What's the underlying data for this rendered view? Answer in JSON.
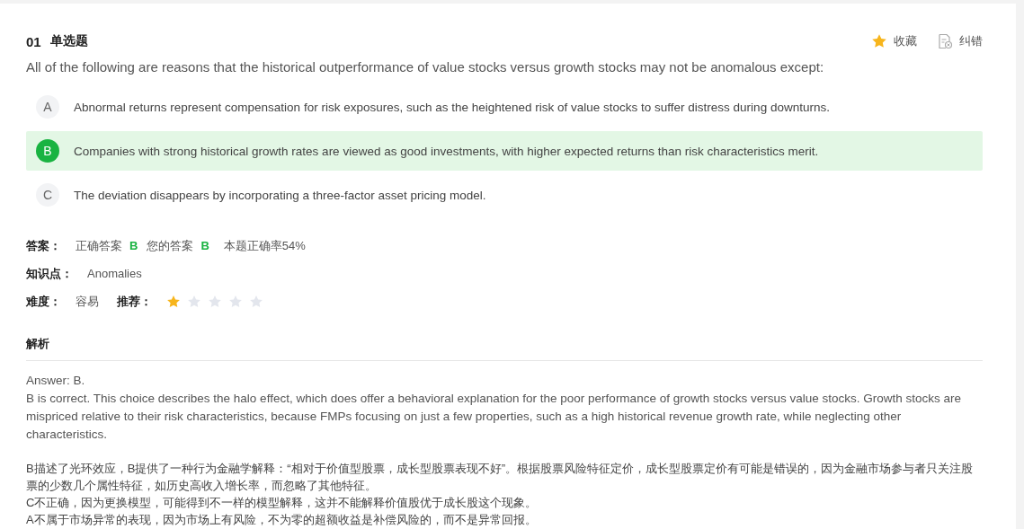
{
  "header": {
    "number": "01",
    "type": "单选题",
    "actions": [
      {
        "kind": "favorite",
        "label": "收藏"
      },
      {
        "kind": "report",
        "label": "纠错"
      }
    ]
  },
  "question": "All of the following are reasons that the historical outperformance of value stocks versus growth stocks may not be anomalous except:",
  "options": [
    {
      "letter": "A",
      "text": "Abnormal returns represent compensation for risk exposures, such as the heightened risk of value stocks to suffer distress during downturns.",
      "selected": false
    },
    {
      "letter": "B",
      "text": "Companies with strong historical growth rates are viewed as good investments, with higher expected returns than risk characteristics merit.",
      "selected": true
    },
    {
      "letter": "C",
      "text": "The deviation disappears by incorporating a three-factor asset pricing model.",
      "selected": false
    }
  ],
  "answer": {
    "label": "答案：",
    "correct_label": "正确答案",
    "correct": "B",
    "yours_label": "您的答案",
    "yours": "B",
    "rate": "本题正确率54%"
  },
  "knowledge": {
    "label": "知识点：",
    "value": "Anomalies"
  },
  "difficulty": {
    "label": "难度：",
    "value": "容易",
    "recommend_label": "推荐：",
    "stars": 1
  },
  "analysis": {
    "title": "解析",
    "english": [
      "Answer: B.",
      "B is correct. This choice describes the halo effect, which does offer a behavioral explanation for the poor performance of growth stocks versus value stocks. Growth stocks are mispriced relative to their risk characteristics, because FMPs focusing on just a few properties, such as a high historical revenue growth rate, while neglecting other characteristics."
    ],
    "chinese": [
      "B描述了光环效应，B提供了一种行为金融学解释：“相对于价值型股票，成长型股票表现不好”。根据股票风险特征定价，成长型股票定价有可能是错误的，因为金融市场参与者只关注股票的少数几个属性特征，如历史高收入增长率，而忽略了其他特征。",
      "C不正确，因为更换模型，可能得到不一样的模型解释，这并不能解释价值股优于成长股这个现象。",
      "A不属于市场异常的表现，因为市场上有风险，不为零的超额收益是补偿风险的，而不是异常回报。"
    ]
  }
}
